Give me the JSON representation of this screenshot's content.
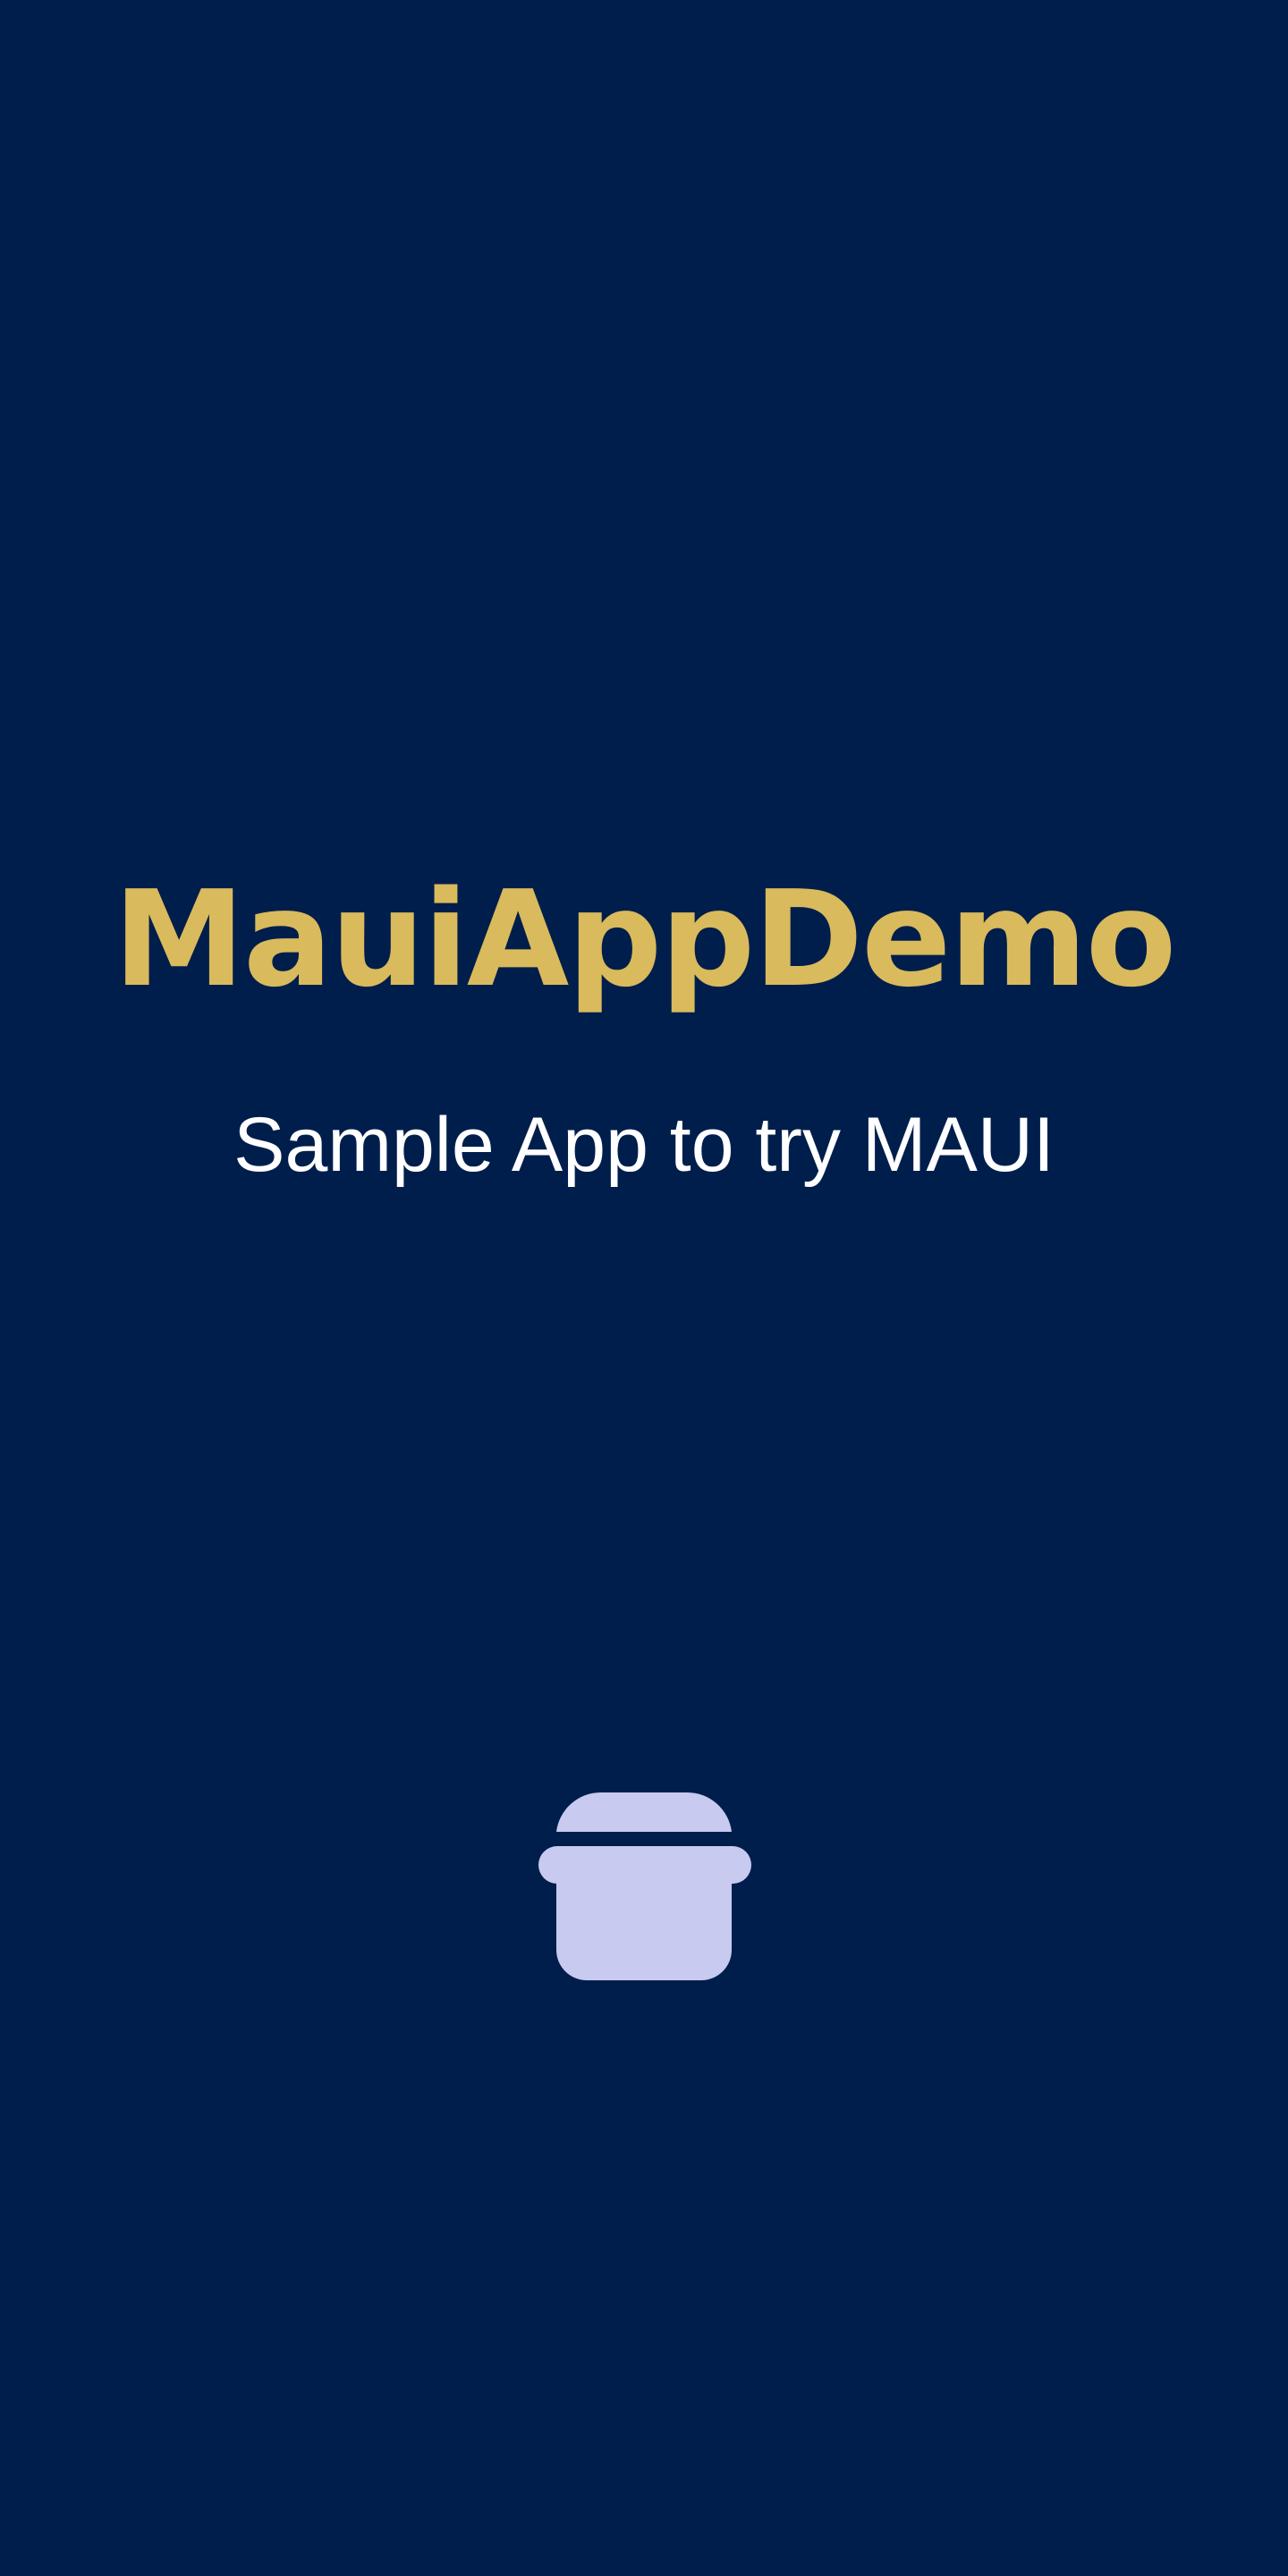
{
  "splash": {
    "title": "MauiAppDemo",
    "subtitle": "Sample App to try MAUI",
    "icon": "cooking-pot-icon"
  },
  "colors": {
    "background": "#001E4C",
    "title": "#D9BA5C",
    "subtitle": "#FFFFFF",
    "icon": "#C8CAF0"
  }
}
